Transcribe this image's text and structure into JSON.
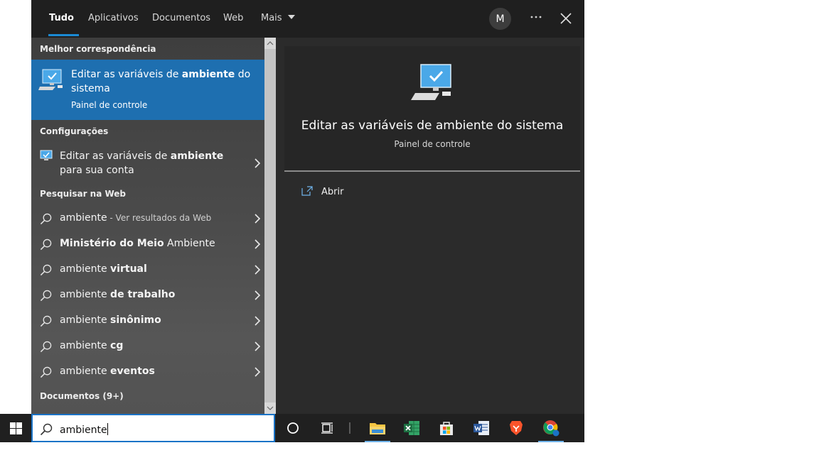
{
  "tabs": [
    "Tudo",
    "Aplicativos",
    "Documentos",
    "Web",
    "Mais"
  ],
  "avatar_letter": "M",
  "sections": {
    "best_match": "Melhor correspondência",
    "settings": "Configurações",
    "web": "Pesquisar na Web",
    "documents": "Documentos (9+)"
  },
  "best_match": {
    "title_before": "Editar as variáveis de ",
    "title_bold": "ambiente",
    "title_after": " do sistema",
    "subtitle": "Painel de controle"
  },
  "settings_item": {
    "before": "Editar as variáveis de ",
    "bold": "ambiente",
    "after": " para sua conta"
  },
  "web_results": [
    {
      "normal": "ambiente",
      "bold": "",
      "hint": " - Ver resultados da Web"
    },
    {
      "normal": " Ambiente",
      "bold": "Ministério do Meio",
      "hint": "",
      "bold_first": true
    },
    {
      "normal": "ambiente ",
      "bold": "virtual",
      "hint": ""
    },
    {
      "normal": "ambiente ",
      "bold": "de trabalho",
      "hint": ""
    },
    {
      "normal": "ambiente ",
      "bold": "sinônimo",
      "hint": ""
    },
    {
      "normal": "ambiente ",
      "bold": "cg",
      "hint": ""
    },
    {
      "normal": "ambiente ",
      "bold": "eventos",
      "hint": ""
    }
  ],
  "detail": {
    "title": "Editar as variáveis de ambiente do sistema",
    "subtitle": "Painel de controle",
    "open_label": "Abrir"
  },
  "search_query": "ambiente",
  "colors": {
    "accent": "#1e6fb0",
    "panel": "#2b2b2b",
    "taskbar": "#202020"
  }
}
